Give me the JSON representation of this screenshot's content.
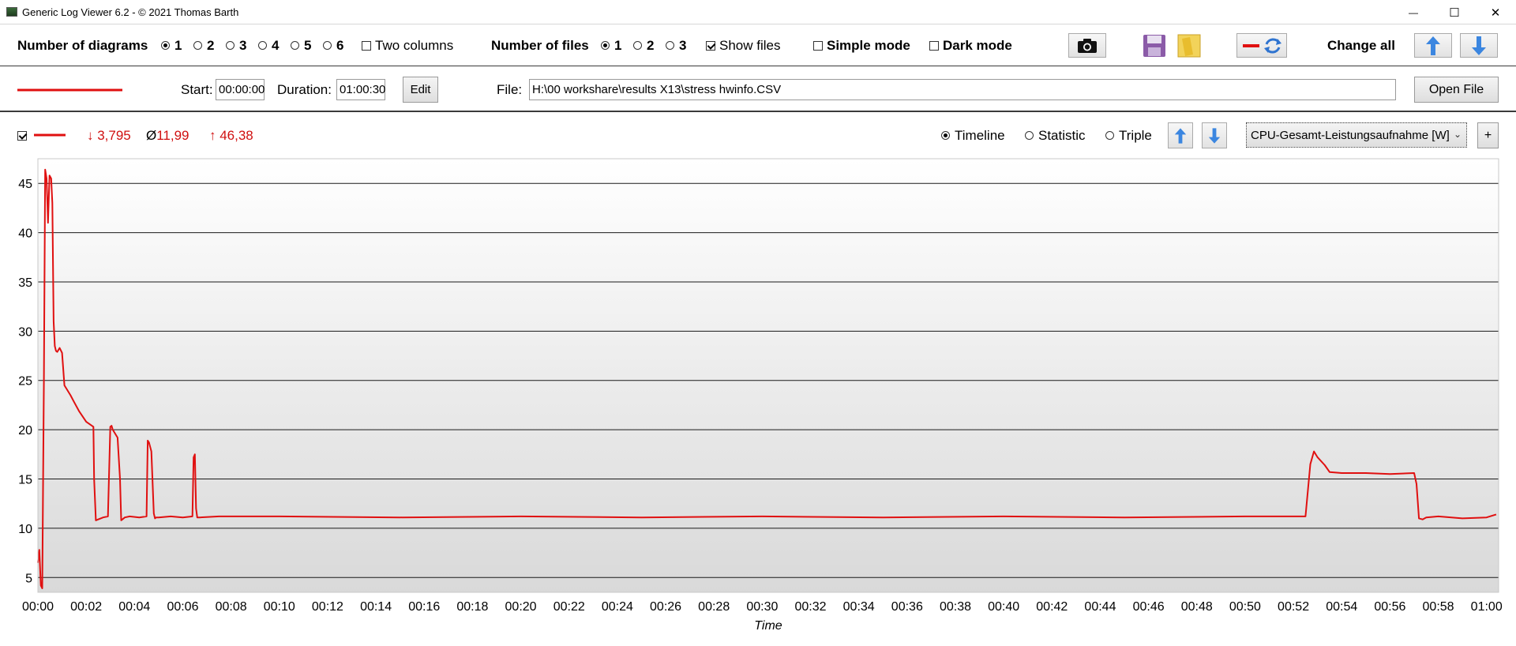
{
  "window": {
    "title": "Generic Log Viewer 6.2 - © 2021 Thomas Barth",
    "minimize": "—",
    "maximize": "☐",
    "close": "✕"
  },
  "toolbar": {
    "num_diagrams_label": "Number of diagrams",
    "diagram_options": [
      "1",
      "2",
      "3",
      "4",
      "5",
      "6"
    ],
    "diagram_selected": "1",
    "two_columns_label": "Two columns",
    "num_files_label": "Number of files",
    "file_options": [
      "1",
      "2",
      "3"
    ],
    "files_selected": "1",
    "show_files_label": "Show files",
    "show_files_checked": true,
    "simple_mode_label": "Simple mode",
    "dark_mode_label": "Dark mode",
    "change_all_label": "Change all"
  },
  "file_row": {
    "start_label": "Start:",
    "start_value": "00:00:00",
    "duration_label": "Duration:",
    "duration_value": "01:00:30",
    "edit_button": "Edit",
    "file_label": "File:",
    "file_path": "H:\\00 workshare\\results X13\\stress hwinfo.CSV",
    "open_file_button": "Open File",
    "line_color": "#e01010"
  },
  "diagram": {
    "min_value": "↓ 3,795",
    "avg_value": "Ø 11,99",
    "max_value": "↑ 46,38",
    "view_modes": [
      "Timeline",
      "Statistic",
      "Triple"
    ],
    "view_selected": "Timeline",
    "sensor": "CPU-Gesamt-Leistungsaufnahme [W]",
    "add_button": "+",
    "stat_color": "#d01010"
  },
  "chart_data": {
    "type": "line",
    "xlabel": "Time",
    "ylabel": "",
    "x_unit": "minutes",
    "xlim": [
      0,
      60.5
    ],
    "ylim": [
      3.5,
      47.5
    ],
    "yticks": [
      5,
      10,
      15,
      20,
      25,
      30,
      35,
      40,
      45
    ],
    "xticks": [
      "00:00",
      "00:02",
      "00:04",
      "00:06",
      "00:08",
      "00:10",
      "00:12",
      "00:14",
      "00:16",
      "00:18",
      "00:20",
      "00:22",
      "00:24",
      "00:26",
      "00:28",
      "00:30",
      "00:32",
      "00:34",
      "00:36",
      "00:38",
      "00:40",
      "00:42",
      "00:44",
      "00:46",
      "00:48",
      "00:50",
      "00:52",
      "00:54",
      "00:56",
      "00:58",
      "01:00"
    ],
    "grid": true,
    "series": [
      {
        "color": "#e01010",
        "x": [
          0.0,
          0.06,
          0.12,
          0.18,
          0.25,
          0.3,
          0.36,
          0.42,
          0.48,
          0.55,
          0.6,
          0.65,
          0.7,
          0.75,
          0.8,
          0.9,
          1.0,
          1.1,
          1.2,
          1.35,
          1.5,
          1.7,
          2.0,
          2.3,
          2.33,
          2.4,
          2.5,
          2.7,
          2.9,
          3.0,
          3.05,
          3.1,
          3.3,
          3.4,
          3.45,
          3.5,
          3.6,
          3.8,
          4.2,
          4.5,
          4.55,
          4.6,
          4.7,
          4.8,
          4.85,
          4.9,
          5.0,
          5.5,
          6.0,
          6.4,
          6.45,
          6.5,
          6.55,
          6.6,
          6.7,
          7.5,
          10,
          15,
          20,
          25,
          30,
          35,
          40,
          45,
          50,
          52.5,
          52.7,
          52.85,
          53.0,
          53.3,
          53.5,
          54,
          55,
          56,
          57.0,
          57.1,
          57.2,
          57.35,
          57.5,
          58,
          59,
          60,
          60.4
        ],
        "y": [
          6.5,
          7.8,
          4.2,
          3.9,
          25,
          46.4,
          45.5,
          41,
          45.8,
          45.5,
          43,
          31,
          28.5,
          28.0,
          27.9,
          28.3,
          27.8,
          24.5,
          24.1,
          23.5,
          22.8,
          21.9,
          20.8,
          20.3,
          15,
          10.8,
          10.9,
          11.1,
          11.2,
          20.3,
          20.4,
          20.0,
          19.2,
          15,
          10.8,
          10.9,
          11.1,
          11.2,
          11.1,
          11.2,
          18.9,
          18.7,
          17.8,
          11.5,
          11.0,
          11.1,
          11.1,
          11.2,
          11.1,
          11.2,
          17.2,
          17.5,
          12,
          11.1,
          11.1,
          11.2,
          11.2,
          11.1,
          11.2,
          11.1,
          11.2,
          11.1,
          11.2,
          11.1,
          11.2,
          11.2,
          16.5,
          17.8,
          17.2,
          16.4,
          15.7,
          15.6,
          15.6,
          15.5,
          15.6,
          14.5,
          11.0,
          10.9,
          11.1,
          11.2,
          11.0,
          11.1,
          11.4
        ]
      }
    ]
  }
}
